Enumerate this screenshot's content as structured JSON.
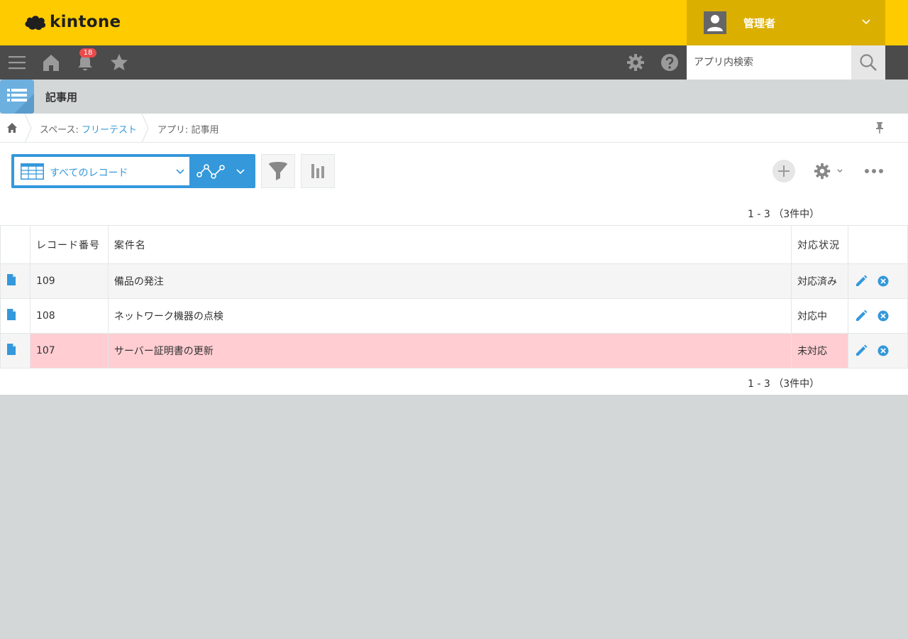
{
  "header": {
    "logo_text": "kintone",
    "user_name": "管理者"
  },
  "nav": {
    "notification_count": "18",
    "search_placeholder": "アプリ内検索"
  },
  "app": {
    "title": "記事用"
  },
  "breadcrumb": {
    "space_prefix": "スペース: ",
    "space_name": "フリーテスト",
    "app_item": "アプリ: 記事用"
  },
  "toolbar": {
    "view_label": "すべてのレコード"
  },
  "pager": {
    "top": "1 - 3 （3件中）",
    "bottom": "1 - 3 （3件中）"
  },
  "table": {
    "columns": [
      "レコード番号",
      "案件名",
      "対応状況"
    ],
    "rows": [
      {
        "number": "109",
        "name": "備品の発注",
        "status": "対応済み"
      },
      {
        "number": "108",
        "name": "ネットワーク機器の点検",
        "status": "対応中"
      },
      {
        "number": "107",
        "name": "サーバー証明書の更新",
        "status": "未対応"
      }
    ]
  },
  "colors": {
    "header_yellow": "#fecb00",
    "user_box": "#dbaf00",
    "nav_dark": "#4b4b4b",
    "accent_blue": "#3498db",
    "highlight_row": "#ffcdd2"
  }
}
